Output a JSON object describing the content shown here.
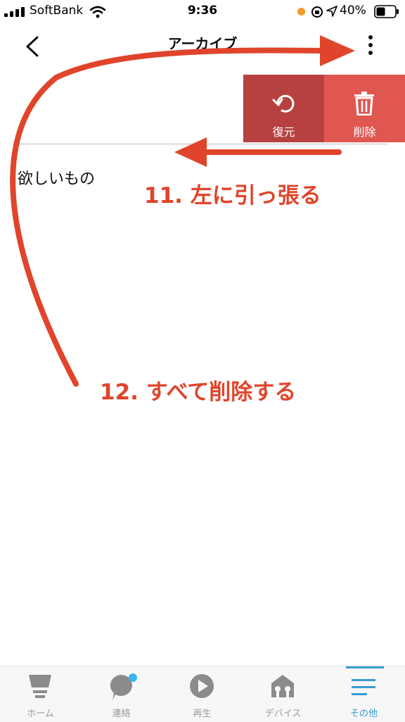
{
  "status": {
    "carrier": "SoftBank",
    "time": "9:36",
    "battery": "40%"
  },
  "nav": {
    "title": "アーカイブ"
  },
  "actions": {
    "restore": "復元",
    "delete": "削除"
  },
  "row": {
    "title": "欲しいもの"
  },
  "annotations": {
    "step11": "11. 左に引っ張る",
    "step12": "12. すべて削除する"
  },
  "tabs": [
    {
      "label": "ホーム",
      "icon": "home-icon"
    },
    {
      "label": "連絡",
      "icon": "chat-icon"
    },
    {
      "label": "再生",
      "icon": "play-icon"
    },
    {
      "label": "デバイス",
      "icon": "devices-icon"
    },
    {
      "label": "その他",
      "icon": "menu-icon",
      "active": true
    }
  ],
  "colors": {
    "accent": "#3a9ad3",
    "delete": "#e05752",
    "restore": "#b64140",
    "annotation": "#e0452b"
  }
}
